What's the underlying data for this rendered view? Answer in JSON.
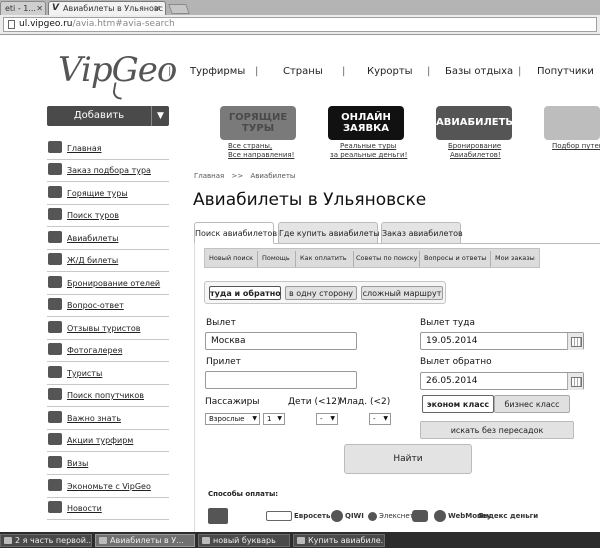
{
  "browser": {
    "tabs": [
      {
        "label": "eti - 1..."
      },
      {
        "label": "Авиабилеты в Ульяновс"
      }
    ],
    "tab_favicon": "V",
    "url_host": "ul.vipgeo.ru",
    "url_path": "/avia.htm#avia-search"
  },
  "site": {
    "logo": "VipGeo",
    "nav": [
      "Турфирмы",
      "Страны",
      "Курорты",
      "Базы отдыха",
      "Попутчики"
    ]
  },
  "sidebar": {
    "add_label": "Добавить",
    "items": [
      {
        "label": "Главная",
        "icon": "home-icon"
      },
      {
        "label": "Заказ подбора тура",
        "icon": "palm-icon"
      },
      {
        "label": "Горящие туры",
        "icon": "lighter-icon"
      },
      {
        "label": "Поиск туров",
        "icon": "search-icon"
      },
      {
        "label": "Авиабилеты",
        "icon": "airplane-icon"
      },
      {
        "label": "Ж/Д билеты",
        "icon": "train-icon"
      },
      {
        "label": "Бронирование отелей",
        "icon": "bed-icon"
      },
      {
        "label": "Вопрос-ответ",
        "icon": "question-icon"
      },
      {
        "label": "Отзывы туристов",
        "icon": "chat-icon"
      },
      {
        "label": "Фотогалерея",
        "icon": "camera-icon"
      },
      {
        "label": "Туристы",
        "icon": "people-icon"
      },
      {
        "label": "Поиск попутчиков",
        "icon": "suitcase-icon"
      },
      {
        "label": "Важно знать",
        "icon": "note-icon"
      },
      {
        "label": "Акции турфирм",
        "icon": "tag-icon"
      },
      {
        "label": "Визы",
        "icon": "visa-icon"
      },
      {
        "label": "Экономьте с VipGeo",
        "icon": "percent-icon"
      },
      {
        "label": "Новости",
        "icon": "info-icon"
      }
    ]
  },
  "banners": [
    {
      "title": "ГОРЯЩИЕ ТУРЫ",
      "caption1": "Все страны,",
      "caption2": "Все направления!"
    },
    {
      "title": "ОНЛАЙН ЗАЯВКА",
      "caption1": "Реальные туры",
      "caption2": "за реальные деньги!"
    },
    {
      "title": "АВИАБИЛЕТЫ",
      "caption1": "Бронирование",
      "caption2": "Авиабилетов!"
    },
    {
      "title": "",
      "caption1": "Подбор путев",
      "caption2": ""
    }
  ],
  "breadcrumb": {
    "home": "Главная",
    "sep": ">>",
    "current": "Авиабилеты"
  },
  "page_title": "Авиабилеты в Ульяновске",
  "content_tabs": [
    "Поиск авиабилетов",
    "Где купить авиабилеты",
    "Заказ авиабилетов"
  ],
  "subnav": [
    "Новый поиск",
    "Помощь",
    "Как оплатить",
    "Советы по поиску",
    "Вопросы и ответы",
    "Мои заказы"
  ],
  "route_options": [
    "туда и обратно",
    "в одну сторону",
    "сложный маршрут"
  ],
  "form": {
    "from_label": "Вылет",
    "from_value": "Москва",
    "to_label": "Прилет",
    "to_value": "",
    "depart_label": "Вылет туда",
    "depart_value": "19.05.2014",
    "return_label": "Вылет обратно",
    "return_value": "26.05.2014",
    "passengers_label": "Пассажиры",
    "children_label": "Дети (<12)",
    "infants_label": "Млад. (<2)",
    "adult_type": "Взрослые",
    "adult_count": "1",
    "children_count": "-",
    "infants_count": "-",
    "class_economy": "эконом класс",
    "class_business": "бизнес класс",
    "direct_label": "искать без пересадок",
    "submit_label": "Найти"
  },
  "payment": {
    "heading": "Способы оплаты:",
    "methods": [
      "Евросеть",
      "QIWI",
      "Элекснет",
      "WebMoney",
      "Яндекс деньги"
    ]
  },
  "taskbar": [
    "2 я часть первой...",
    "Авиабилеты в У...",
    "новый букварь",
    "Купить авиабиле..."
  ]
}
